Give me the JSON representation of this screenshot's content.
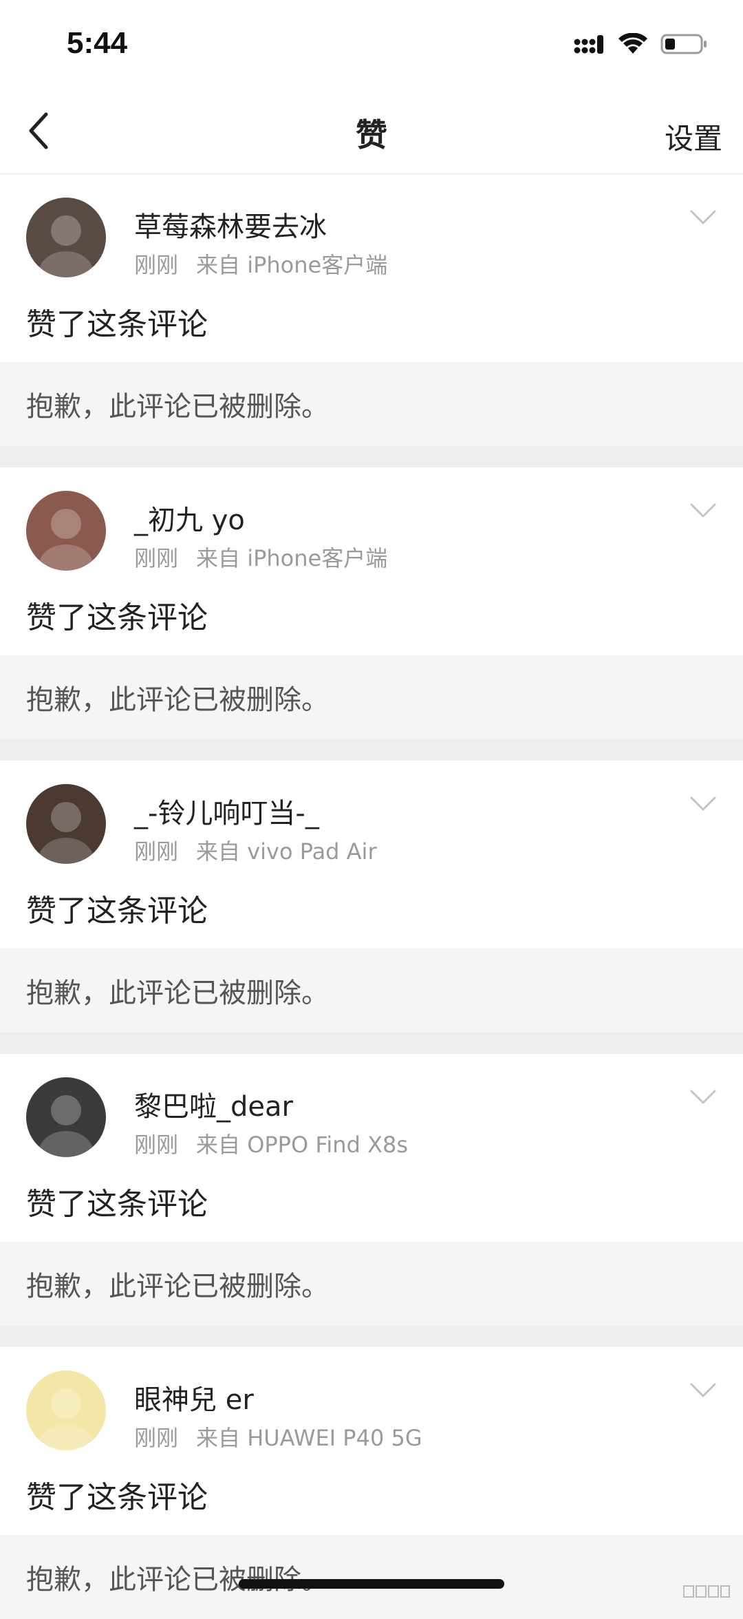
{
  "status_bar": {
    "time": "5:44",
    "icons": [
      "signal-icon",
      "wifi-icon",
      "battery-icon"
    ]
  },
  "nav": {
    "back_icon": "chevron-left-icon",
    "title": "赞",
    "settings_label": "设置"
  },
  "items": [
    {
      "username": "草莓森林要去冰",
      "time": "刚刚",
      "source": "来自 iPhone客户端",
      "action": "赞了这条评论",
      "quote": "抱歉，此评论已被删除。",
      "avatar_color": "#5a4a44"
    },
    {
      "username": "_初九 yo",
      "time": "刚刚",
      "source": "来自 iPhone客户端",
      "action": "赞了这条评论",
      "quote": "抱歉，此评论已被删除。",
      "avatar_color": "#8a5a4e"
    },
    {
      "username": "_-铃儿响叮当-_",
      "time": "刚刚",
      "source": "来自 vivo Pad Air",
      "action": "赞了这条评论",
      "quote": "抱歉，此评论已被删除。",
      "avatar_color": "#4a3a32"
    },
    {
      "username": "黎巴啦_dear",
      "time": "刚刚",
      "source": "来自 OPPO Find X8s",
      "action": "赞了这条评论",
      "quote": "抱歉，此评论已被删除。",
      "avatar_color": "#3c3a3c"
    },
    {
      "username": "眼神兒 er",
      "time": "刚刚",
      "source": "来自 HUAWEI P40 5G",
      "action": "赞了这条评论",
      "quote": "抱歉，此评论已被删除。",
      "avatar_color": "#f3e7a8"
    }
  ],
  "colors": {
    "separator": "#ededed",
    "quote_bg": "#f5f5f5",
    "meta_text": "#9a9a9a"
  }
}
